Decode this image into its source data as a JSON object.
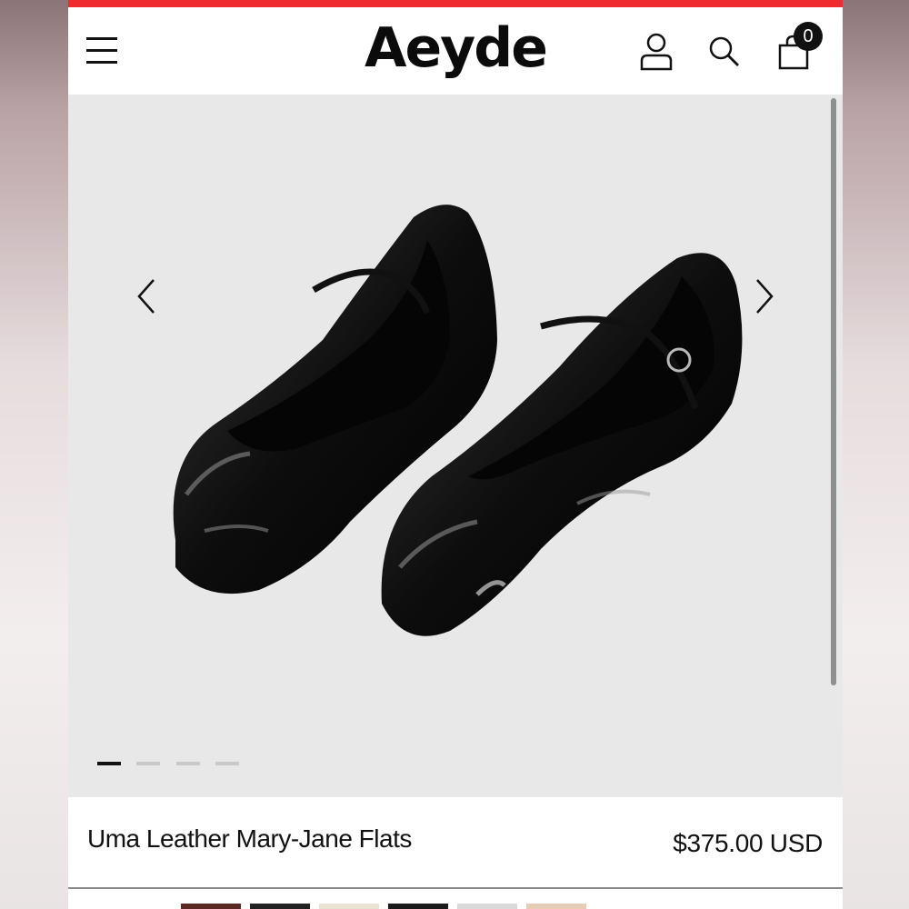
{
  "header": {
    "logo": "Aeyde",
    "cart_count": "0",
    "icons": [
      "menu-icon",
      "account-icon",
      "search-icon",
      "bag-icon"
    ]
  },
  "gallery": {
    "image_alt": "Black patent leather Mary-Jane flats",
    "slide_count": 4,
    "active_slide": 1,
    "prev_icon": "chevron-left-icon",
    "next_icon": "chevron-right-icon"
  },
  "product": {
    "name": "Uma Leather Mary-Jane Flats",
    "price": "$375.00 USD"
  },
  "swatches": [
    {
      "color": "#5a2a22"
    },
    {
      "color": "#222222"
    },
    {
      "color": "#e9e3d4"
    },
    {
      "color": "#1a1a1a"
    },
    {
      "color": "#d9d9d9"
    },
    {
      "color": "#e8cdb6"
    }
  ],
  "colors": {
    "accent_bar": "#ef2b2d",
    "text": "#111111",
    "gallery_bg": "#e8e8e8"
  }
}
